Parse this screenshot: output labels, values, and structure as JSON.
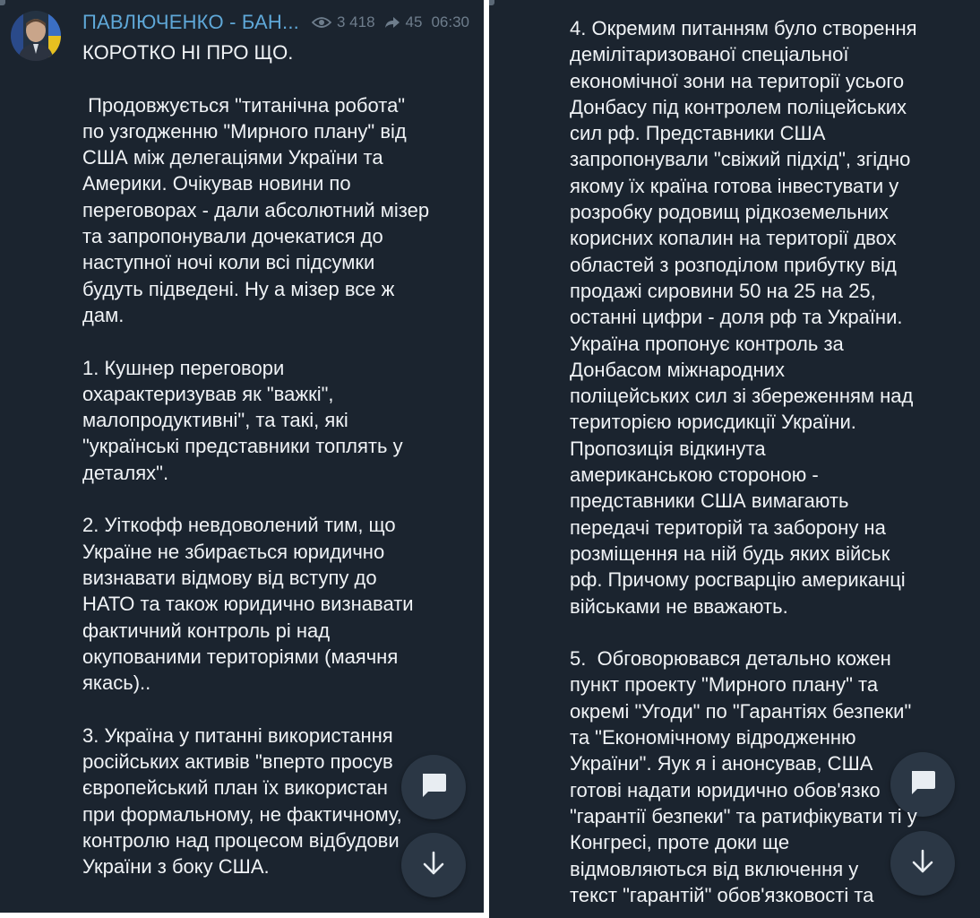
{
  "channel": {
    "name": "ПАВЛЮЧЕНКО - БАН...",
    "views": "3 418",
    "forwards": "45",
    "time": "06:30"
  },
  "message": {
    "left_text": "КОРОТКО НІ ПРО ЩО.\n\n Продовжується \"титанічна робота\"\nпо узгодженню \"Мирного плану\" від\nСША між делегаціями України та\nАмерики. Очікував новини по\nпереговорах - дали абсолютний мізер\nта запропонували дочекатися до\nнаступної ночі коли всі підсумки\nбудуть підведені. Ну а мізер все ж\nдам.\n\n1. Кушнер переговори\nохарактеризував як \"важкі\",\nмалопродуктивні\", та такі, які\n\"українські представники топлять у\nдеталях\".\n\n2. Уіткофф невдоволений тим, що\nУкраїне не збирається юридично\nвизнавати відмову від вступу до\nНАТО та також юридично визнавати\nфактичний контроль рі над\nокупованими територіями (маячня\nякась)..\n\n3. Україна у питанні використання\nросійських активів \"вперто просув\nєвропейський план їх використан\nпри формальному, не фактичному,\nконтролю над процесом відбудови\nУкраїни з боку США.",
    "right_text": "4. Окремим питанням було створення\nдемілітаризованої спеціальної\nекономічної зони на території усього\nДонбасу під контролем поліцейських\nсил рф. Представники США\nзапропонували \"свіжий підхід\", згідно\nякому їх країна готова інвестувати у\nрозробку родовищ рідкоземельних\nкорисних копалин на території двох\nобластей з розподілом прибутку від\nпродажі сировини 50 на 25 на 25,\nостанні цифри - доля рф та України.\nУкраїна пропонує контроль за\nДонбасом міжнародних\nполіцейських сил зі збереженням над\nтериторією юрисдикції України.\nПропозиція відкинута\nамериканською стороною -\nпредставники США вимагають\nпередачі територій та заборону на\nрозміщення на ній будь яких військ\nрф. Причому росгварцію американці\nвійськами не вважають.\n\n5.  Обговорювався детально кожен\nпункт проекту \"Мирного плану\" та\nокремі \"Угоди\" по \"Гарантіях безпеки\"\nта \"Економічному відродженню\nУкраїни\". Яук я і анонсував, США\nготові надати юридично обов'язко\n\"гарантії безпеки\" та ратифікувати ті у\nКонгресі, проте доки ще\nвідмовляються від включення у\nтекст \"гарантій\" обов'язковості та"
  },
  "icons": {
    "views": "eye-icon",
    "forwards": "forward-arrow-icon",
    "comment": "chat-bubble-icon",
    "scroll_down": "arrow-down-icon",
    "avatar": "channel-avatar"
  },
  "colors": {
    "background": "#1b242f",
    "channel_name": "#5fa8d8",
    "meta_text": "#6e7d8c",
    "message_text": "#f0f3f6",
    "fab_background": "#2b3745",
    "fab_icon": "#e8edf2"
  }
}
